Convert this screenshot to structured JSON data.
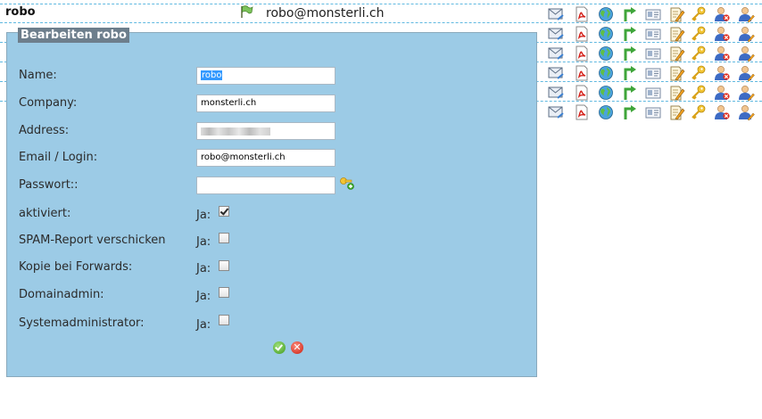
{
  "header": {
    "title": "robo",
    "email": "robo@monsterli.ch"
  },
  "form": {
    "legend": "Bearbeiten robo",
    "fields": {
      "name": {
        "label": "Name:",
        "value": "robo"
      },
      "company": {
        "label": "Company:",
        "value": "monsterli.ch"
      },
      "address": {
        "label": "Address:",
        "value": ""
      },
      "email": {
        "label": "Email / Login:",
        "value": "robo@monsterli.ch"
      },
      "password": {
        "label": "Passwort::",
        "value": ""
      }
    },
    "checks": [
      {
        "label": "aktiviert:",
        "ja": "Ja:",
        "checked": true
      },
      {
        "label": "SPAM-Report verschicken",
        "ja": "Ja:",
        "checked": false
      },
      {
        "label": "Kopie bei Forwards:",
        "ja": "Ja:",
        "checked": false
      },
      {
        "label": "Domainadmin:",
        "ja": "Ja:",
        "checked": false
      },
      {
        "label": "Systemadministrator:",
        "ja": "Ja:",
        "checked": false
      }
    ]
  },
  "icons": {
    "row_count": 6,
    "names": [
      "mail-icon",
      "pdf-icon",
      "globe-icon",
      "forward-arrow-icon",
      "card-icon",
      "edit-document-icon",
      "key-icon",
      "user-delete-icon",
      "user-edit-icon"
    ],
    "colors": {
      "accent": "#9ccbe6",
      "legend": "#6d7e8c",
      "dashed": "#5fb8e0"
    }
  }
}
